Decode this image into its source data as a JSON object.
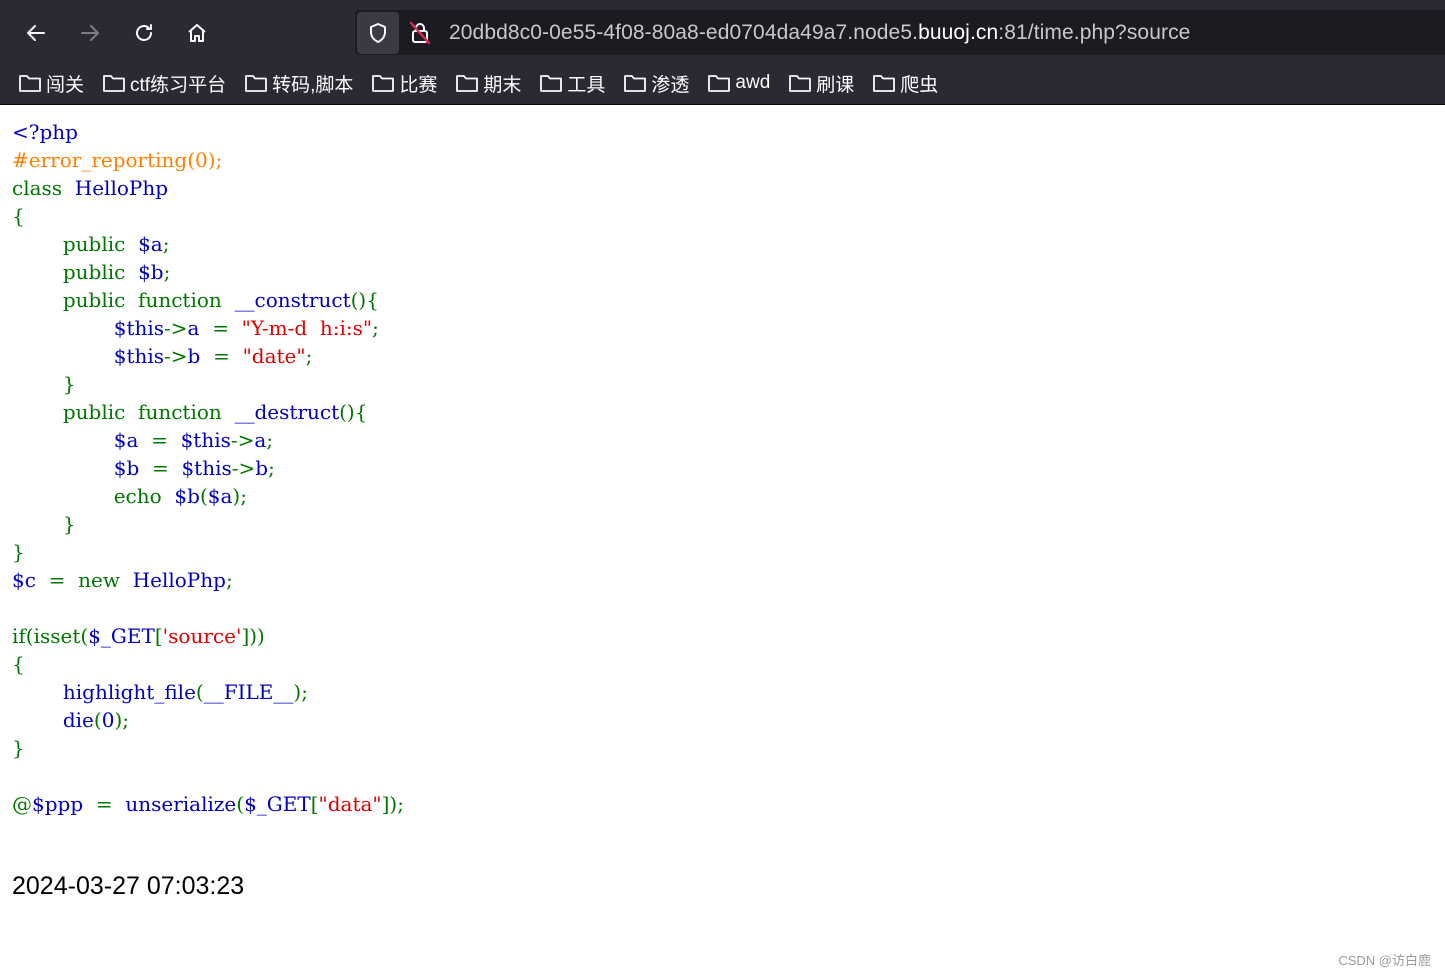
{
  "browser": {
    "url_prefix": "20dbd8c0-0e55-4f08-80a8-ed0704da49a7.node5.",
    "url_domain": "buuoj.cn",
    "url_suffix": ":81/time.php?source",
    "icons": [
      "back-arrow-icon",
      "forward-arrow-icon",
      "reload-icon",
      "home-icon",
      "shield-icon",
      "insecure-lock-icon",
      "folder-icon"
    ],
    "bookmarks": [
      "闯关",
      "ctf练习平台",
      "转码,脚本",
      "比赛",
      "期末",
      "工具",
      "渗透",
      "awd",
      "刷课",
      "爬虫"
    ]
  },
  "source_code": [
    {
      "tokens": [
        {
          "text": "<?php",
          "c": "df"
        }
      ]
    },
    {
      "tokens": [
        {
          "text": "#error_reporting(0);",
          "c": "cm"
        }
      ]
    },
    {
      "tokens": [
        {
          "text": "class  ",
          "c": "kw"
        },
        {
          "text": "HelloPhp",
          "c": "df"
        }
      ]
    },
    {
      "tokens": [
        {
          "text": "{",
          "c": "kw"
        }
      ]
    },
    {
      "tokens": [
        {
          "text": "        public  ",
          "c": "kw"
        },
        {
          "text": "$a",
          "c": "df"
        },
        {
          "text": ";",
          "c": "kw"
        }
      ]
    },
    {
      "tokens": [
        {
          "text": "        public  ",
          "c": "kw"
        },
        {
          "text": "$b",
          "c": "df"
        },
        {
          "text": ";",
          "c": "kw"
        }
      ]
    },
    {
      "tokens": [
        {
          "text": "        public  function  ",
          "c": "kw"
        },
        {
          "text": "__construct",
          "c": "df"
        },
        {
          "text": "(){",
          "c": "kw"
        }
      ]
    },
    {
      "tokens": [
        {
          "text": "                ",
          "c": "kw"
        },
        {
          "text": "$this",
          "c": "df"
        },
        {
          "text": "->",
          "c": "kw"
        },
        {
          "text": "a  ",
          "c": "df"
        },
        {
          "text": "=  ",
          "c": "kw"
        },
        {
          "text": "\"Y-m-d  h:i:s\"",
          "c": "st"
        },
        {
          "text": ";",
          "c": "kw"
        }
      ]
    },
    {
      "tokens": [
        {
          "text": "                ",
          "c": "kw"
        },
        {
          "text": "$this",
          "c": "df"
        },
        {
          "text": "->",
          "c": "kw"
        },
        {
          "text": "b  ",
          "c": "df"
        },
        {
          "text": "=  ",
          "c": "kw"
        },
        {
          "text": "\"date\"",
          "c": "st"
        },
        {
          "text": ";",
          "c": "kw"
        }
      ]
    },
    {
      "tokens": [
        {
          "text": "        }",
          "c": "kw"
        }
      ]
    },
    {
      "tokens": [
        {
          "text": "        public  function  ",
          "c": "kw"
        },
        {
          "text": "__destruct",
          "c": "df"
        },
        {
          "text": "(){",
          "c": "kw"
        }
      ]
    },
    {
      "tokens": [
        {
          "text": "                ",
          "c": "kw"
        },
        {
          "text": "$a  ",
          "c": "df"
        },
        {
          "text": "=  ",
          "c": "kw"
        },
        {
          "text": "$this",
          "c": "df"
        },
        {
          "text": "->",
          "c": "kw"
        },
        {
          "text": "a",
          "c": "df"
        },
        {
          "text": ";",
          "c": "kw"
        }
      ]
    },
    {
      "tokens": [
        {
          "text": "                ",
          "c": "kw"
        },
        {
          "text": "$b  ",
          "c": "df"
        },
        {
          "text": "=  ",
          "c": "kw"
        },
        {
          "text": "$this",
          "c": "df"
        },
        {
          "text": "->",
          "c": "kw"
        },
        {
          "text": "b",
          "c": "df"
        },
        {
          "text": ";",
          "c": "kw"
        }
      ]
    },
    {
      "tokens": [
        {
          "text": "                echo  ",
          "c": "kw"
        },
        {
          "text": "$b",
          "c": "df"
        },
        {
          "text": "(",
          "c": "kw"
        },
        {
          "text": "$a",
          "c": "df"
        },
        {
          "text": ");",
          "c": "kw"
        }
      ]
    },
    {
      "tokens": [
        {
          "text": "        }",
          "c": "kw"
        }
      ]
    },
    {
      "tokens": [
        {
          "text": "}",
          "c": "kw"
        }
      ]
    },
    {
      "tokens": [
        {
          "text": "$c  ",
          "c": "df"
        },
        {
          "text": "=  new  ",
          "c": "kw"
        },
        {
          "text": "HelloPhp",
          "c": "df"
        },
        {
          "text": ";",
          "c": "kw"
        }
      ]
    },
    {
      "tokens": [
        {
          "text": "",
          "c": "df"
        }
      ]
    },
    {
      "tokens": [
        {
          "text": "if(isset(",
          "c": "kw"
        },
        {
          "text": "$_GET",
          "c": "df"
        },
        {
          "text": "[",
          "c": "kw"
        },
        {
          "text": "'source'",
          "c": "st"
        },
        {
          "text": "]))",
          "c": "kw"
        }
      ]
    },
    {
      "tokens": [
        {
          "text": "{",
          "c": "kw"
        }
      ]
    },
    {
      "tokens": [
        {
          "text": "        ",
          "c": "kw"
        },
        {
          "text": "highlight_file",
          "c": "df"
        },
        {
          "text": "(",
          "c": "kw"
        },
        {
          "text": "__FILE__",
          "c": "df"
        },
        {
          "text": ");",
          "c": "kw"
        }
      ]
    },
    {
      "tokens": [
        {
          "text": "        ",
          "c": "kw"
        },
        {
          "text": "die",
          "c": "df"
        },
        {
          "text": "(",
          "c": "kw"
        },
        {
          "text": "0",
          "c": "df"
        },
        {
          "text": ");",
          "c": "kw"
        }
      ]
    },
    {
      "tokens": [
        {
          "text": "}",
          "c": "kw"
        }
      ]
    },
    {
      "tokens": [
        {
          "text": "",
          "c": "df"
        }
      ]
    },
    {
      "tokens": [
        {
          "text": "@",
          "c": "kw"
        },
        {
          "text": "$ppp  ",
          "c": "df"
        },
        {
          "text": "=  ",
          "c": "kw"
        },
        {
          "text": "unserialize",
          "c": "df"
        },
        {
          "text": "(",
          "c": "kw"
        },
        {
          "text": "$_GET",
          "c": "df"
        },
        {
          "text": "[",
          "c": "kw"
        },
        {
          "text": "\"data\"",
          "c": "st"
        },
        {
          "text": "]);",
          "c": "kw"
        }
      ]
    }
  ],
  "output_time": "2024-03-27 07:03:23",
  "watermark": "CSDN @访白鹿",
  "colors": {
    "keyword": "#007700",
    "default": "#0000bb",
    "string": "#dd0000",
    "comment": "#ff8000",
    "chrome_bg": "#1c1b22",
    "toolbar_bg": "#2b2a33"
  }
}
